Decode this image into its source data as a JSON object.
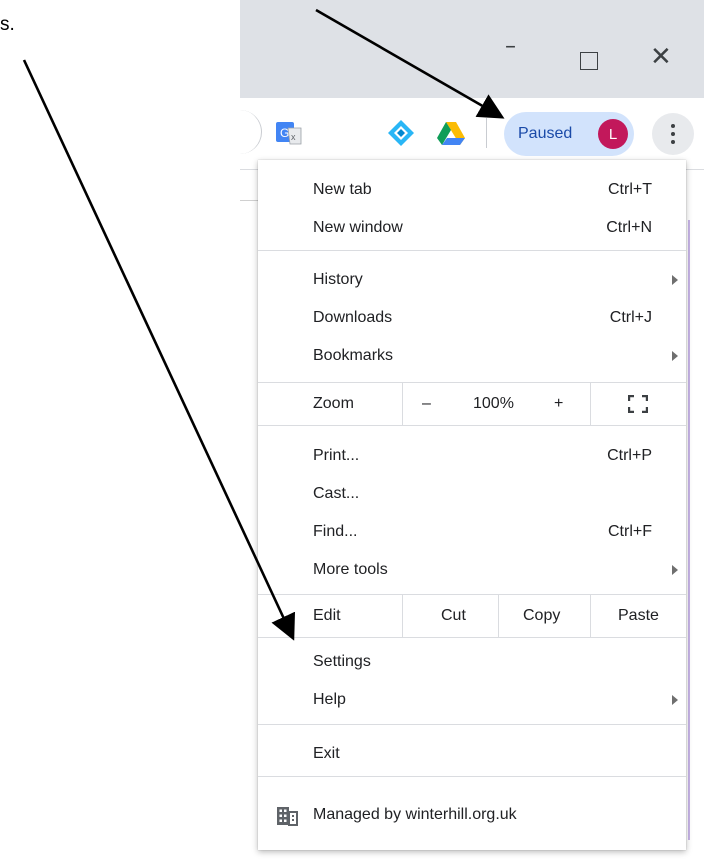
{
  "doc_fragment": "s.",
  "window": {
    "minimize": "–",
    "close": "✕"
  },
  "toolbar": {
    "extensions": [
      "google-translate-icon",
      "diamond-extension-icon",
      "google-drive-icon"
    ],
    "paused_label": "Paused",
    "avatar_letter": "L",
    "colors": {
      "chip_bg": "#d2e3fc",
      "avatar_bg": "#c2185b"
    }
  },
  "menu": {
    "new_tab": {
      "label": "New tab",
      "shortcut": "Ctrl+T"
    },
    "new_window": {
      "label": "New window",
      "shortcut": "Ctrl+N"
    },
    "history": {
      "label": "History"
    },
    "downloads": {
      "label": "Downloads",
      "shortcut": "Ctrl+J"
    },
    "bookmarks": {
      "label": "Bookmarks"
    },
    "zoom": {
      "label": "Zoom",
      "minus": "–",
      "level": "100%",
      "plus": "+"
    },
    "print": {
      "label": "Print...",
      "shortcut": "Ctrl+P"
    },
    "cast": {
      "label": "Cast..."
    },
    "find": {
      "label": "Find...",
      "shortcut": "Ctrl+F"
    },
    "more_tools": {
      "label": "More tools"
    },
    "edit": {
      "label": "Edit",
      "cut": "Cut",
      "copy": "Copy",
      "paste": "Paste"
    },
    "settings": {
      "label": "Settings"
    },
    "help": {
      "label": "Help"
    },
    "exit": {
      "label": "Exit"
    },
    "managed": {
      "label": "Managed by winterhill.org.uk"
    }
  }
}
